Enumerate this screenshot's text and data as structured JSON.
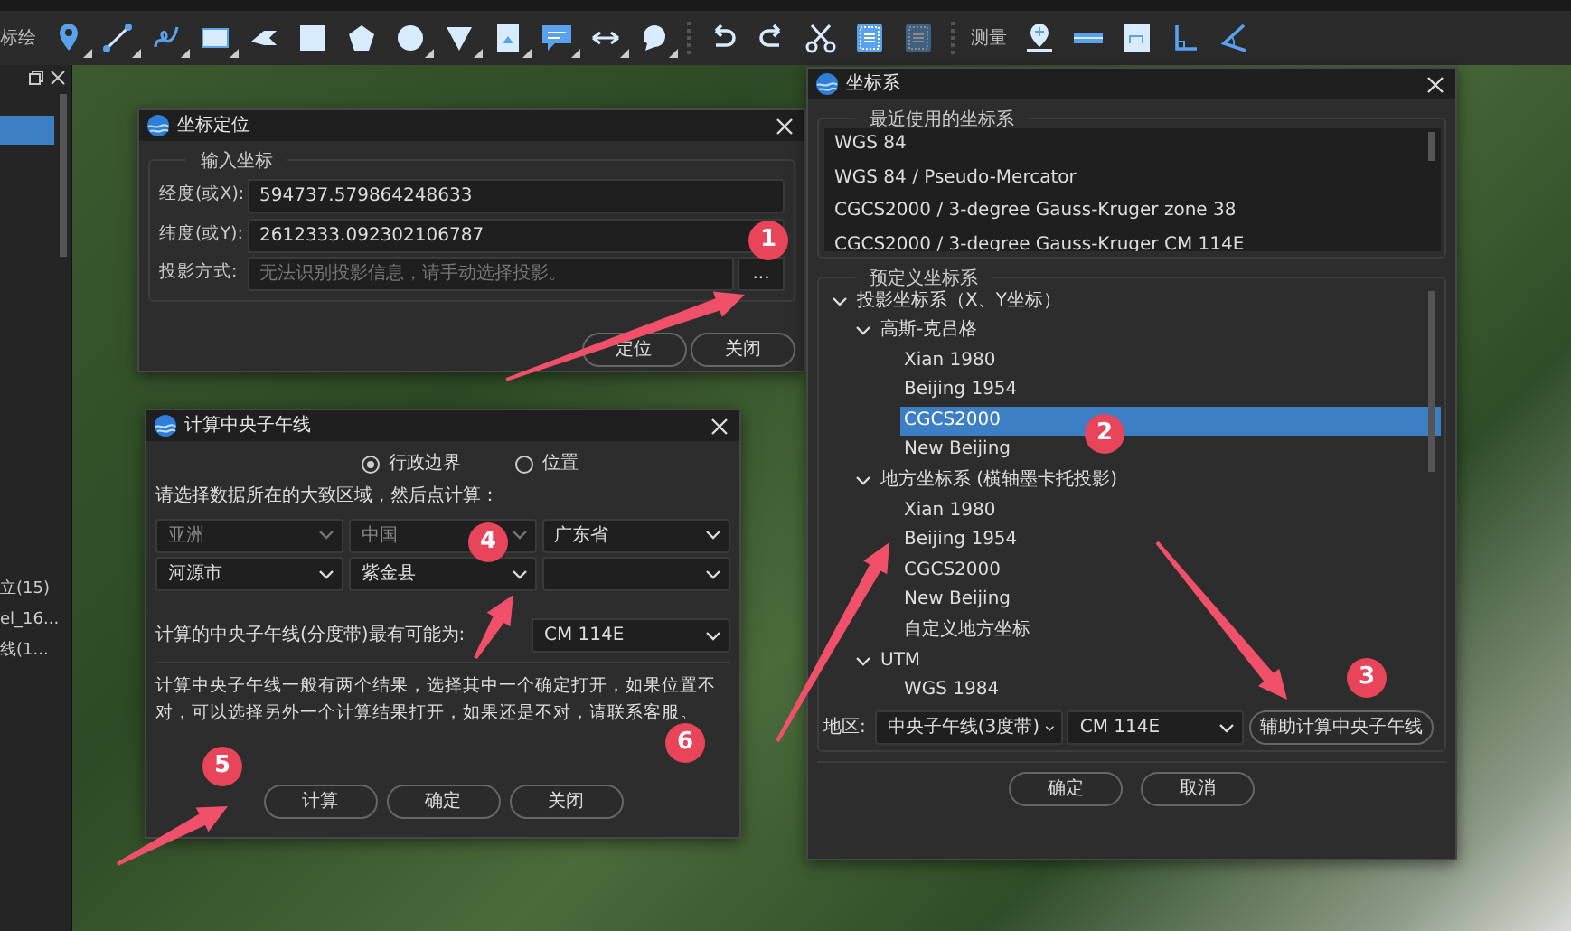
{
  "toolbar": {
    "items": [
      {
        "kind": "label",
        "text": "标绘"
      },
      {
        "kind": "tool",
        "dropdown": true
      },
      {
        "kind": "tool",
        "dropdown": true
      },
      {
        "kind": "tool",
        "dropdown": true
      },
      {
        "kind": "tool",
        "dropdown": true
      },
      {
        "kind": "tool",
        "dropdown": false
      },
      {
        "kind": "tool",
        "dropdown": false
      },
      {
        "kind": "tool",
        "dropdown": false
      },
      {
        "kind": "tool",
        "dropdown": true
      },
      {
        "kind": "tool",
        "dropdown": true
      },
      {
        "kind": "tool",
        "dropdown": true
      },
      {
        "kind": "tool",
        "dropdown": true
      },
      {
        "kind": "tool",
        "dropdown": true
      },
      {
        "kind": "tool",
        "dropdown": true
      },
      {
        "kind": "separator"
      },
      {
        "kind": "tool"
      },
      {
        "kind": "tool"
      },
      {
        "kind": "tool"
      },
      {
        "kind": "tool",
        "disabled": false
      },
      {
        "kind": "tool",
        "disabled": true
      },
      {
        "kind": "separator"
      },
      {
        "kind": "label",
        "text": "测量"
      },
      {
        "kind": "tool"
      },
      {
        "kind": "tool"
      },
      {
        "kind": "tool"
      },
      {
        "kind": "tool"
      },
      {
        "kind": "tool"
      }
    ]
  },
  "sidebar": {
    "items": [
      {
        "selected": true
      },
      {
        "text": "立(15)",
        "selected": false
      },
      {
        "text": "el_16...",
        "selected": false
      },
      {
        "text": "线(1...",
        "selected": false
      }
    ]
  },
  "locate_dialog": {
    "title": "坐标定位",
    "group": "输入坐标",
    "fields": [
      {
        "label": "经度(或X):",
        "value": "594737.579864248633"
      },
      {
        "label": "纬度(或Y):",
        "value": "2612333.092302106787"
      },
      {
        "label": "投影方式:",
        "placeholder": "无法识别投影信息，请手动选择投影。",
        "button": "..."
      }
    ],
    "buttons": [
      "定位",
      "关闭"
    ]
  },
  "crs_dialog": {
    "title": "坐标系",
    "recent": {
      "title": "最近使用的坐标系",
      "items": [
        "WGS 84",
        "WGS 84 / Pseudo-Mercator",
        "CGCS2000 / 3-degree Gauss-Kruger zone 38",
        "CGCS2000 / 3-degree Gauss-Kruger CM 114E"
      ]
    },
    "predefined": {
      "title": "预定义坐标系",
      "tree": [
        {
          "label": "投影坐标系（X、Y坐标）",
          "expanded": true,
          "selected": false,
          "children": [
            {
              "label": "高斯-克吕格",
              "expanded": true,
              "selected": false,
              "children": [
                {
                  "label": "Xian 1980",
                  "selected": false
                },
                {
                  "label": "Beijing 1954",
                  "selected": false
                },
                {
                  "label": "CGCS2000",
                  "selected": true
                },
                {
                  "label": "New Beijing",
                  "selected": false
                }
              ]
            },
            {
              "label": "地方坐标系 (横轴墨卡托投影)",
              "expanded": true,
              "selected": false,
              "children": [
                {
                  "label": "Xian 1980",
                  "selected": false
                },
                {
                  "label": "Beijing 1954",
                  "selected": false
                },
                {
                  "label": "CGCS2000",
                  "selected": false
                },
                {
                  "label": "New Beijing",
                  "selected": false
                },
                {
                  "label": "自定义地方坐标",
                  "selected": false
                }
              ]
            },
            {
              "label": "UTM",
              "expanded": true,
              "selected": false,
              "children": [
                {
                  "label": "WGS 1984",
                  "selected": false
                }
              ]
            }
          ]
        }
      ]
    },
    "region_label": "地区:",
    "zone": "中央子午线(3度带)",
    "meridian": "CM 114E",
    "assist_button": "辅助计算中央子午线",
    "buttons": [
      "确定",
      "取消"
    ]
  },
  "cm_dialog": {
    "title": "计算中央子午线",
    "modes": [
      {
        "label": "行政边界",
        "selected": true
      },
      {
        "label": "位置",
        "selected": false
      }
    ],
    "prompt": "请选择数据所在的大致区域，然后点计算：",
    "regions": [
      {
        "value": "亚洲",
        "disabled": true
      },
      {
        "value": "中国",
        "disabled": true
      },
      {
        "value": "广东省",
        "disabled": false
      },
      {
        "value": "河源市",
        "disabled": false
      },
      {
        "value": "紫金县",
        "disabled": false
      },
      {
        "disabled": false
      }
    ],
    "result_label": "计算的中央子午线(分度带)最有可能为:",
    "result": "CM 114E",
    "note": "计算中央子午线一般有两个结果，选择其中一个确定打开，如果位置不对，可以选择另外一个计算结果打开，如果还是不对，请联系客服。",
    "buttons": [
      "计算",
      "确定",
      "关闭"
    ]
  },
  "annotations": [
    "1",
    "2",
    "3",
    "4",
    "5",
    "6"
  ]
}
